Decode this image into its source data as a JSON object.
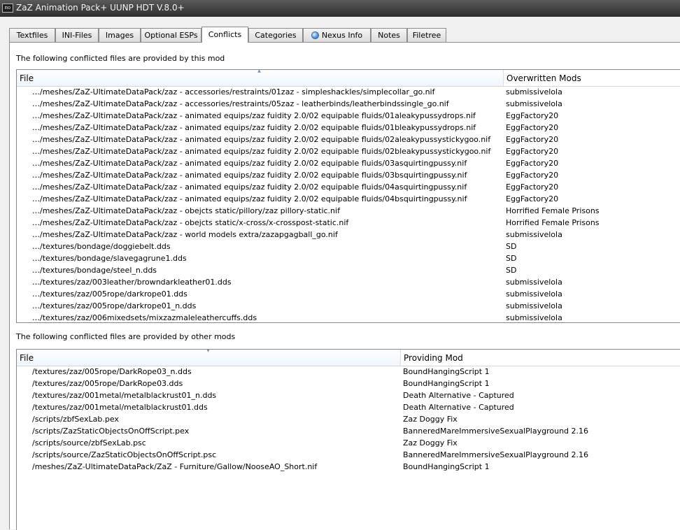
{
  "window": {
    "title": "ZaZ Animation Pack+ UUNP HDT V.8.0+",
    "icon_label": "mo"
  },
  "tabs": [
    {
      "label": "Textfiles",
      "icon": null
    },
    {
      "label": "INI-Files",
      "icon": null
    },
    {
      "label": "Images",
      "icon": null
    },
    {
      "label": "Optional ESPs",
      "icon": null
    },
    {
      "label": "Conflicts",
      "icon": null
    },
    {
      "label": "Categories",
      "icon": null
    },
    {
      "label": "Nexus Info",
      "icon": "globe-icon"
    },
    {
      "label": "Notes",
      "icon": null
    },
    {
      "label": "Filetree",
      "icon": null
    }
  ],
  "active_tab": "Conflicts",
  "provided_by_this_mod": {
    "caption": "The following conflicted files are provided by this mod",
    "columns": [
      "File",
      "Overwritten Mods"
    ],
    "rows": [
      [
        "…/meshes/ZaZ-UltimateDataPack/zaz - accessories/restraints/01zaz - simpleshackles/simplecollar_go.nif",
        "submissivelola"
      ],
      [
        "…/meshes/ZaZ-UltimateDataPack/zaz - accessories/restraints/05zaz - leatherbinds/leatherbindssingle_go.nif",
        "submissivelola"
      ],
      [
        "…/meshes/ZaZ-UltimateDataPack/zaz - animated equips/zaz fuidity 2.0/02 equipable fluids/01aleakypussydrops.nif",
        "EggFactory20"
      ],
      [
        "…/meshes/ZaZ-UltimateDataPack/zaz - animated equips/zaz fuidity 2.0/02 equipable fluids/01bleakypussydrops.nif",
        "EggFactory20"
      ],
      [
        "…/meshes/ZaZ-UltimateDataPack/zaz - animated equips/zaz fuidity 2.0/02 equipable fluids/02aleakypussystickygoo.nif",
        "EggFactory20"
      ],
      [
        "…/meshes/ZaZ-UltimateDataPack/zaz - animated equips/zaz fuidity 2.0/02 equipable fluids/02bleakypussystickygoo.nif",
        "EggFactory20"
      ],
      [
        "…/meshes/ZaZ-UltimateDataPack/zaz - animated equips/zaz fuidity 2.0/02 equipable fluids/03asquirtingpussy.nif",
        "EggFactory20"
      ],
      [
        "…/meshes/ZaZ-UltimateDataPack/zaz - animated equips/zaz fuidity 2.0/02 equipable fluids/03bsquirtingpussy.nif",
        "EggFactory20"
      ],
      [
        "…/meshes/ZaZ-UltimateDataPack/zaz - animated equips/zaz fuidity 2.0/02 equipable fluids/04asquirtingpussy.nif",
        "EggFactory20"
      ],
      [
        "…/meshes/ZaZ-UltimateDataPack/zaz - animated equips/zaz fuidity 2.0/02 equipable fluids/04bsquirtingpussy.nif",
        "EggFactory20"
      ],
      [
        "…/meshes/ZaZ-UltimateDataPack/zaz - obejcts  static/pillory/zaz pillory-static.nif",
        "Horrified Female Prisons"
      ],
      [
        "…/meshes/ZaZ-UltimateDataPack/zaz - obejcts  static/x-cross/x-crosspost-static.nif",
        "Horrified Female Prisons"
      ],
      [
        "…/meshes/ZaZ-UltimateDataPack/zaz - world models extra/zazapgagball_go.nif",
        "submissivelola"
      ],
      [
        "…/textures/bondage/doggiebelt.dds",
        "SD"
      ],
      [
        "…/textures/bondage/slavegagrune1.dds",
        "SD"
      ],
      [
        "…/textures/bondage/steel_n.dds",
        "SD"
      ],
      [
        "…/textures/zaz/003leather/browndarkleather01.dds",
        "submissivelola"
      ],
      [
        "…/textures/zaz/005rope/darkrope01.dds",
        "submissivelola"
      ],
      [
        "…/textures/zaz/005rope/darkrope01_n.dds",
        "submissivelola"
      ],
      [
        "…/textures/zaz/006mixedsets/mixzazmaleleathercuffs.dds",
        "submissivelola"
      ]
    ]
  },
  "provided_by_other_mods": {
    "caption": "The following conflicted files are provided by other mods",
    "columns": [
      "File",
      "Providing Mod"
    ],
    "rows": [
      [
        "/textures/zaz/005rope/DarkRope03_n.dds",
        "BoundHangingScript 1"
      ],
      [
        "/textures/zaz/005rope/DarkRope03.dds",
        "BoundHangingScript 1"
      ],
      [
        "/textures/zaz/001metal/metalblackrust01_n.dds",
        "Death Alternative - Captured"
      ],
      [
        "/textures/zaz/001metal/metalblackrust01.dds",
        "Death Alternative - Captured"
      ],
      [
        "/scripts/zbfSexLab.pex",
        "Zaz Doggy Fix"
      ],
      [
        "/scripts/ZazStaticObjectsOnOffScript.pex",
        "BanneredMareImmersiveSexualPlayground 2.16"
      ],
      [
        "/scripts/source/zbfSexLab.psc",
        "Zaz Doggy Fix"
      ],
      [
        "/scripts/source/ZazStaticObjectsOnOffScript.psc",
        "BanneredMareImmersiveSexualPlayground 2.16"
      ],
      [
        "/meshes/ZaZ-UltimateDataPack/ZaZ - Furniture/Gallow/NooseAO_Short.nif",
        "BoundHangingScript 1"
      ]
    ]
  }
}
